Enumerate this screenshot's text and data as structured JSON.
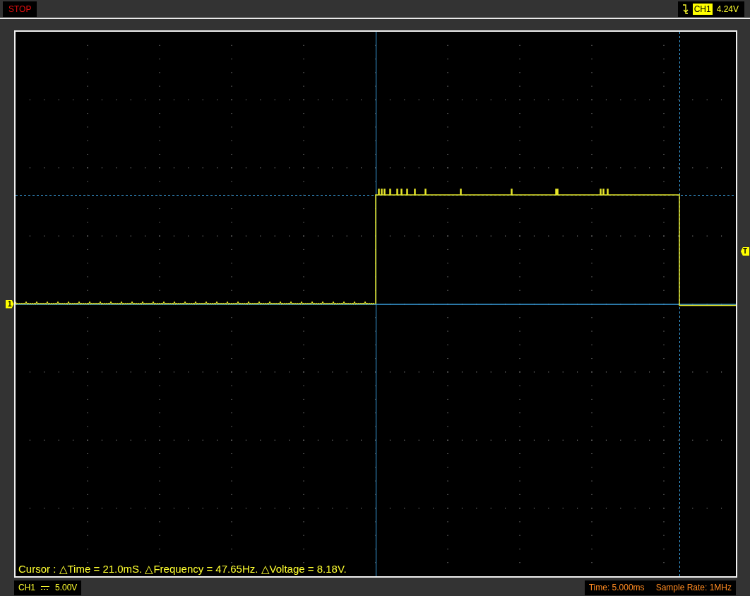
{
  "top_bar": {
    "status": "STOP",
    "trigger": {
      "channel": "CH1",
      "voltage": "4.24V"
    }
  },
  "screen": {
    "channel_marker": "1",
    "trigger_marker": "T",
    "cursor_readout": "Cursor : △Time = 21.0mS. △Frequency = 47.65Hz. △Voltage = 8.18V."
  },
  "bottom_bar": {
    "channel": "CH1",
    "volts_per_div": "5.00V",
    "timebase": "Time: 5.000ms",
    "sample_rate": "Sample Rate: 1MHz"
  }
}
